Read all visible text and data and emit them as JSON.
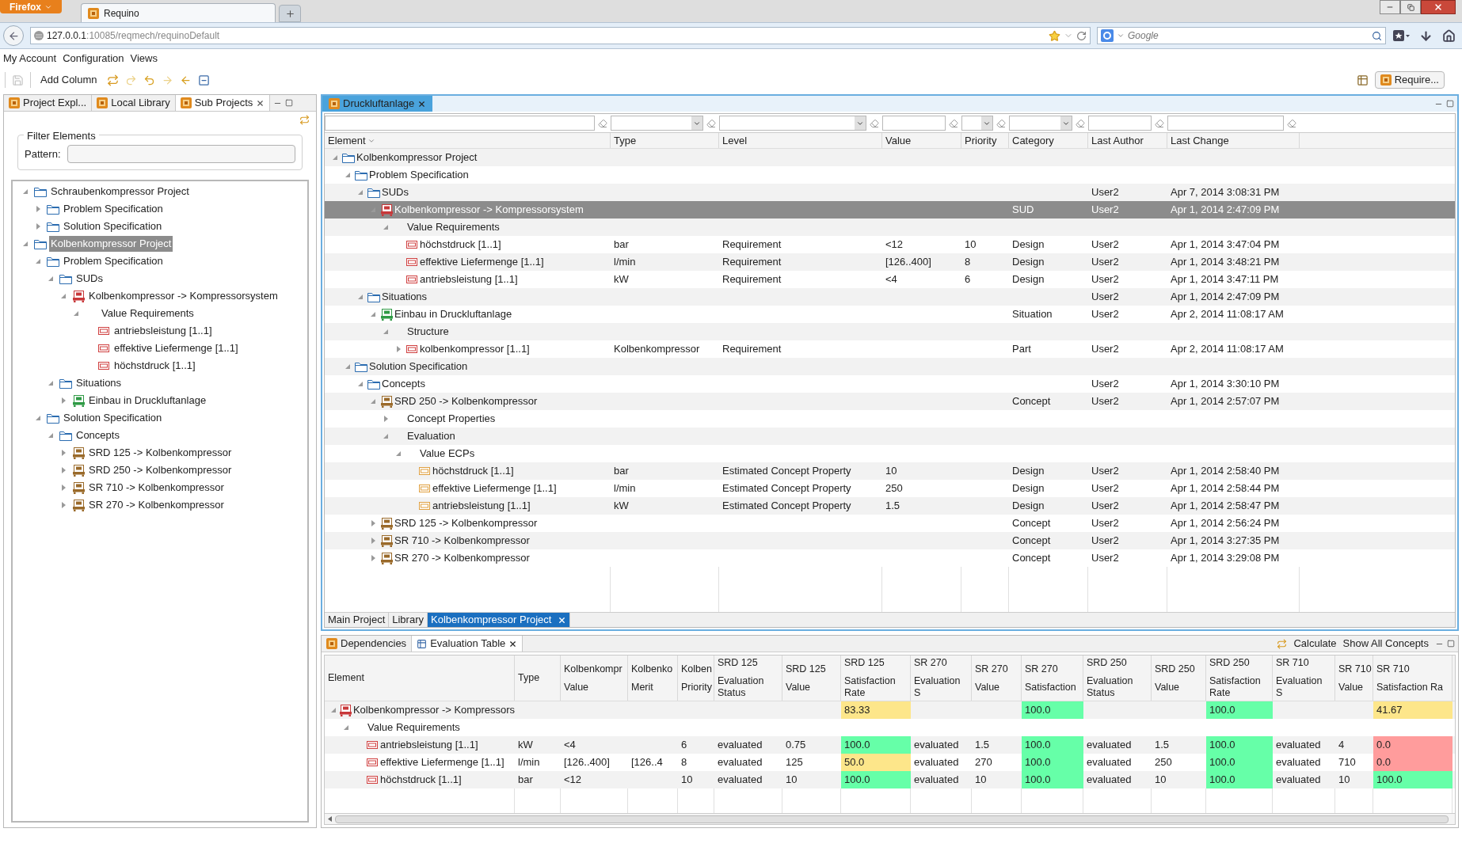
{
  "browser": {
    "menu_button": "Firefox",
    "tab_title": "Requino",
    "url_host": "127.0.0.1",
    "url_rest": ":10085/reqmech/requinoDefault",
    "search_placeholder": "Google"
  },
  "menu": [
    "My Account",
    "Configuration",
    "Views"
  ],
  "toolbar": {
    "add_column": "Add Column",
    "perspective": "Require..."
  },
  "left_panel": {
    "tabs": [
      {
        "label": "Project Expl...",
        "selected": false
      },
      {
        "label": "Local Library",
        "selected": false
      },
      {
        "label": "Sub Projects",
        "selected": true
      }
    ],
    "filter_group": "Filter Elements",
    "pattern_label": "Pattern:",
    "tree": [
      {
        "label": "Schraubenkompressor Project",
        "kind": "folder",
        "expandable": true,
        "expanded": true,
        "selected": false,
        "children": [
          {
            "label": "Problem Specification",
            "kind": "folder",
            "expandable": true,
            "expanded": false,
            "selected": false
          },
          {
            "label": "Solution Specification",
            "kind": "folder",
            "expandable": true,
            "expanded": false,
            "selected": false
          }
        ]
      },
      {
        "label": "Kolbenkompressor Project",
        "kind": "folder",
        "expandable": true,
        "expanded": true,
        "selected": true,
        "children": [
          {
            "label": "Problem Specification",
            "kind": "folder",
            "expandable": true,
            "expanded": true,
            "selected": false,
            "children": [
              {
                "label": "SUDs",
                "kind": "folder",
                "expandable": true,
                "expanded": true,
                "selected": false,
                "children": [
                  {
                    "label": "Kolbenkompressor -> Kompressorsystem",
                    "kind": "sud",
                    "expandable": true,
                    "expanded": true,
                    "selected": false,
                    "children": [
                      {
                        "label": "Value Requirements",
                        "kind": "group",
                        "expandable": true,
                        "expanded": true,
                        "selected": false,
                        "children": [
                          {
                            "label": "antriebsleistung [1..1]",
                            "kind": "requirement",
                            "expandable": false,
                            "selected": false
                          },
                          {
                            "label": "effektive Liefermenge [1..1]",
                            "kind": "requirement",
                            "expandable": false,
                            "selected": false
                          },
                          {
                            "label": "höchstdruck [1..1]",
                            "kind": "requirement",
                            "expandable": false,
                            "selected": false
                          }
                        ]
                      }
                    ]
                  }
                ]
              },
              {
                "label": "Situations",
                "kind": "folder",
                "expandable": true,
                "expanded": true,
                "selected": false,
                "children": [
                  {
                    "label": "Einbau in Druckluftanlage",
                    "kind": "situation",
                    "expandable": true,
                    "expanded": false,
                    "selected": false
                  }
                ]
              }
            ]
          },
          {
            "label": "Solution Specification",
            "kind": "folder",
            "expandable": true,
            "expanded": true,
            "selected": false,
            "children": [
              {
                "label": "Concepts",
                "kind": "folder",
                "expandable": true,
                "expanded": true,
                "selected": false,
                "children": [
                  {
                    "label": "SRD 125 -> Kolbenkompressor",
                    "kind": "concept",
                    "expandable": true,
                    "expanded": false,
                    "selected": false
                  },
                  {
                    "label": "SRD 250 -> Kolbenkompressor",
                    "kind": "concept",
                    "expandable": true,
                    "expanded": false,
                    "selected": false
                  },
                  {
                    "label": "SR 710 -> Kolbenkompressor",
                    "kind": "concept",
                    "expandable": true,
                    "expanded": false,
                    "selected": false
                  },
                  {
                    "label": "SR 270 -> Kolbenkompressor",
                    "kind": "concept",
                    "expandable": true,
                    "expanded": false,
                    "selected": false
                  }
                ]
              }
            ]
          }
        ]
      }
    ]
  },
  "main_panel": {
    "tab": "Druckluftanlage",
    "columns": [
      {
        "label": "Element",
        "kind": "text",
        "sorted": true
      },
      {
        "label": "Type",
        "kind": "select",
        "sorted": false
      },
      {
        "label": "Level",
        "kind": "select",
        "sorted": false
      },
      {
        "label": "Value",
        "kind": "text",
        "sorted": false
      },
      {
        "label": "Priority",
        "kind": "select",
        "sorted": false
      },
      {
        "label": "Category",
        "kind": "select",
        "sorted": false
      },
      {
        "label": "Last Author",
        "kind": "text",
        "sorted": false
      },
      {
        "label": "Last Change",
        "kind": "text",
        "sorted": false
      }
    ],
    "rows": [
      {
        "kind": "folder",
        "expandable": true,
        "expanded": true,
        "selected": false,
        "cells": [
          "Kolbenkompressor Project",
          "",
          "",
          "",
          "",
          "",
          "",
          ""
        ],
        "children": [
          {
            "kind": "folder",
            "expandable": true,
            "expanded": true,
            "selected": false,
            "cells": [
              "Problem Specification",
              "",
              "",
              "",
              "",
              "",
              "",
              ""
            ],
            "children": [
              {
                "kind": "folder",
                "expandable": true,
                "expanded": true,
                "selected": false,
                "cells": [
                  "SUDs",
                  "",
                  "",
                  "",
                  "",
                  "",
                  "User2",
                  "Apr 7, 2014 3:08:31 PM"
                ],
                "children": [
                  {
                    "kind": "sud",
                    "expandable": true,
                    "expanded": true,
                    "selected": true,
                    "cells": [
                      "Kolbenkompressor -> Kompressorsystem",
                      "",
                      "",
                      "",
                      "",
                      "SUD",
                      "User2",
                      "Apr 1, 2014 2:47:09 PM"
                    ],
                    "children": [
                      {
                        "kind": "group",
                        "expandable": true,
                        "expanded": true,
                        "selected": false,
                        "cells": [
                          "Value Requirements",
                          "",
                          "",
                          "",
                          "",
                          "",
                          "",
                          ""
                        ],
                        "children": [
                          {
                            "kind": "requirement",
                            "expandable": false,
                            "selected": false,
                            "cells": [
                              "höchstdruck [1..1]",
                              "bar",
                              "Requirement",
                              "<12",
                              "10",
                              "Design",
                              "User2",
                              "Apr 1, 2014 3:47:04 PM"
                            ]
                          },
                          {
                            "kind": "requirement",
                            "expandable": false,
                            "selected": false,
                            "cells": [
                              "effektive Liefermenge [1..1]",
                              "l/min",
                              "Requirement",
                              "[126..400]",
                              "8",
                              "Design",
                              "User2",
                              "Apr 1, 2014 3:48:21 PM"
                            ]
                          },
                          {
                            "kind": "requirement",
                            "expandable": false,
                            "selected": false,
                            "cells": [
                              "antriebsleistung [1..1]",
                              "kW",
                              "Requirement",
                              "<4",
                              "6",
                              "Design",
                              "User2",
                              "Apr 1, 2014 3:47:11 PM"
                            ]
                          }
                        ]
                      }
                    ]
                  }
                ]
              },
              {
                "kind": "folder",
                "expandable": true,
                "expanded": true,
                "selected": false,
                "cells": [
                  "Situations",
                  "",
                  "",
                  "",
                  "",
                  "",
                  "User2",
                  "Apr 1, 2014 2:47:09 PM"
                ],
                "children": [
                  {
                    "kind": "situation",
                    "expandable": true,
                    "expanded": true,
                    "selected": false,
                    "cells": [
                      "Einbau in Druckluftanlage",
                      "",
                      "",
                      "",
                      "",
                      "Situation",
                      "User2",
                      "Apr 2, 2014 11:08:17 AM"
                    ],
                    "children": [
                      {
                        "kind": "group",
                        "expandable": true,
                        "expanded": true,
                        "selected": false,
                        "cells": [
                          "Structure",
                          "",
                          "",
                          "",
                          "",
                          "",
                          "",
                          ""
                        ],
                        "children": [
                          {
                            "kind": "requirement",
                            "expandable": true,
                            "expanded": false,
                            "selected": false,
                            "cells": [
                              "kolbenkompressor [1..1]",
                              "Kolbenkompressor",
                              "Requirement",
                              "",
                              "",
                              "Part",
                              "User2",
                              "Apr 2, 2014 11:08:17 AM"
                            ]
                          }
                        ]
                      }
                    ]
                  }
                ]
              }
            ]
          },
          {
            "kind": "folder",
            "expandable": true,
            "expanded": true,
            "selected": false,
            "cells": [
              "Solution Specification",
              "",
              "",
              "",
              "",
              "",
              "",
              ""
            ],
            "children": [
              {
                "kind": "folder",
                "expandable": true,
                "expanded": true,
                "selected": false,
                "cells": [
                  "Concepts",
                  "",
                  "",
                  "",
                  "",
                  "",
                  "User2",
                  "Apr 1, 2014 3:30:10 PM"
                ],
                "children": [
                  {
                    "kind": "concept",
                    "expandable": true,
                    "expanded": true,
                    "selected": false,
                    "cells": [
                      "SRD 250 -> Kolbenkompressor",
                      "",
                      "",
                      "",
                      "",
                      "Concept",
                      "User2",
                      "Apr 1, 2014 2:57:07 PM"
                    ],
                    "children": [
                      {
                        "kind": "group",
                        "expandable": true,
                        "expanded": false,
                        "selected": false,
                        "cells": [
                          "Concept Properties",
                          "",
                          "",
                          "",
                          "",
                          "",
                          "",
                          ""
                        ]
                      },
                      {
                        "kind": "group",
                        "expandable": true,
                        "expanded": true,
                        "selected": false,
                        "cells": [
                          "Evaluation",
                          "",
                          "",
                          "",
                          "",
                          "",
                          "",
                          ""
                        ],
                        "children": [
                          {
                            "kind": "group",
                            "expandable": true,
                            "expanded": true,
                            "selected": false,
                            "cells": [
                              "Value ECPs",
                              "",
                              "",
                              "",
                              "",
                              "",
                              "",
                              ""
                            ],
                            "children": [
                              {
                                "kind": "ecp",
                                "expandable": false,
                                "selected": false,
                                "cells": [
                                  "höchstdruck [1..1]",
                                  "bar",
                                  "Estimated Concept Property",
                                  "10",
                                  "",
                                  "Design",
                                  "User2",
                                  "Apr 1, 2014 2:58:40 PM"
                                ]
                              },
                              {
                                "kind": "ecp",
                                "expandable": false,
                                "selected": false,
                                "cells": [
                                  "effektive Liefermenge [1..1]",
                                  "l/min",
                                  "Estimated Concept Property",
                                  "250",
                                  "",
                                  "Design",
                                  "User2",
                                  "Apr 1, 2014 2:58:44 PM"
                                ]
                              },
                              {
                                "kind": "ecp",
                                "expandable": false,
                                "selected": false,
                                "cells": [
                                  "antriebsleistung [1..1]",
                                  "kW",
                                  "Estimated Concept Property",
                                  "1.5",
                                  "",
                                  "Design",
                                  "User2",
                                  "Apr 1, 2014 2:58:47 PM"
                                ]
                              }
                            ]
                          }
                        ]
                      }
                    ]
                  },
                  {
                    "kind": "concept",
                    "expandable": true,
                    "expanded": false,
                    "selected": false,
                    "cells": [
                      "SRD 125 -> Kolbenkompressor",
                      "",
                      "",
                      "",
                      "",
                      "Concept",
                      "User2",
                      "Apr 1, 2014 2:56:24 PM"
                    ]
                  },
                  {
                    "kind": "concept",
                    "expandable": true,
                    "expanded": false,
                    "selected": false,
                    "cells": [
                      "SR 710 -> Kolbenkompressor",
                      "",
                      "",
                      "",
                      "",
                      "Concept",
                      "User2",
                      "Apr 1, 2014 3:27:35 PM"
                    ]
                  },
                  {
                    "kind": "concept",
                    "expandable": true,
                    "expanded": false,
                    "selected": false,
                    "cells": [
                      "SR 270 -> Kolbenkompressor",
                      "",
                      "",
                      "",
                      "",
                      "Concept",
                      "User2",
                      "Apr 1, 2014 3:29:08 PM"
                    ]
                  }
                ]
              }
            ]
          }
        ]
      }
    ],
    "bottom_tabs": [
      {
        "label": "Main Project",
        "selected": false
      },
      {
        "label": "Library",
        "selected": false
      },
      {
        "label": "Kolbenkompressor Project",
        "selected": true
      }
    ]
  },
  "evaluation_panel": {
    "tabs": [
      {
        "label": "Dependencies",
        "selected": false
      },
      {
        "label": "Evaluation Table",
        "selected": true
      }
    ],
    "actions": [
      "Calculate",
      "Show All Concepts"
    ],
    "columns": [
      {
        "label": "Element"
      },
      {
        "label": "Type"
      },
      {
        "group": "Kolbenkompr",
        "label": "Value"
      },
      {
        "group": "Kolbenko",
        "label": "Merit"
      },
      {
        "group": "Kolben",
        "label": "Priority"
      },
      {
        "group": "SRD 125",
        "label": "Evaluation Status"
      },
      {
        "group": "SRD 125",
        "label": "Value"
      },
      {
        "group": "SRD 125",
        "label": "Satisfaction Rate"
      },
      {
        "group": "SR 270",
        "label": "Evaluation S"
      },
      {
        "group": "SR 270",
        "label": "Value"
      },
      {
        "group": "SR 270",
        "label": "Satisfaction"
      },
      {
        "group": "SRD 250",
        "label": "Evaluation Status"
      },
      {
        "group": "SRD 250",
        "label": "Value"
      },
      {
        "group": "SRD 250",
        "label": "Satisfaction Rate"
      },
      {
        "group": "SR 710",
        "label": "Evaluation S"
      },
      {
        "group": "SR 710",
        "label": "Value"
      },
      {
        "group": "SR 710",
        "label": "Satisfaction Ra"
      }
    ],
    "rows": [
      {
        "kind": "sud",
        "expandable": true,
        "expanded": true,
        "cells": [
          "Kolbenkompressor -> Kompressors",
          "",
          "",
          "",
          "",
          "",
          "",
          {
            "text": "83.33",
            "color": "#fde68a"
          },
          "",
          "",
          {
            "text": "100.0",
            "color": "#66ffa8"
          },
          "",
          "",
          {
            "text": "100.0",
            "color": "#66ffa8"
          },
          "",
          "",
          {
            "text": "41.67",
            "color": "#fde68a"
          }
        ],
        "children": [
          {
            "kind": "group",
            "expandable": true,
            "expanded": true,
            "cells": [
              "Value Requirements",
              "",
              "",
              "",
              "",
              "",
              "",
              "",
              "",
              "",
              "",
              "",
              "",
              "",
              "",
              "",
              ""
            ],
            "children": [
              {
                "kind": "requirement",
                "expandable": false,
                "cells": [
                  "antriebsleistung [1..1]",
                  "kW",
                  "<4",
                  "",
                  "6",
                  "evaluated",
                  "0.75",
                  {
                    "text": "100.0",
                    "color": "#66ffa8"
                  },
                  "evaluated",
                  "1.5",
                  {
                    "text": "100.0",
                    "color": "#66ffa8"
                  },
                  "evaluated",
                  "1.5",
                  {
                    "text": "100.0",
                    "color": "#66ffa8"
                  },
                  "evaluated",
                  "4",
                  {
                    "text": "0.0",
                    "color": "#ff9c9c"
                  }
                ]
              },
              {
                "kind": "requirement",
                "expandable": false,
                "cells": [
                  "effektive Liefermenge [1..1]",
                  "l/min",
                  "[126..400]",
                  "[126..4",
                  "8",
                  "evaluated",
                  "125",
                  {
                    "text": "50.0",
                    "color": "#fde68a"
                  },
                  "evaluated",
                  "270",
                  {
                    "text": "100.0",
                    "color": "#66ffa8"
                  },
                  "evaluated",
                  "250",
                  {
                    "text": "100.0",
                    "color": "#66ffa8"
                  },
                  "evaluated",
                  "710",
                  {
                    "text": "0.0",
                    "color": "#ff9c9c"
                  }
                ]
              },
              {
                "kind": "requirement",
                "expandable": false,
                "cells": [
                  "höchstdruck [1..1]",
                  "bar",
                  "<12",
                  "",
                  "10",
                  "evaluated",
                  "10",
                  {
                    "text": "100.0",
                    "color": "#66ffa8"
                  },
                  "evaluated",
                  "10",
                  {
                    "text": "100.0",
                    "color": "#66ffa8"
                  },
                  "evaluated",
                  "10",
                  {
                    "text": "100.0",
                    "color": "#66ffa8"
                  },
                  "evaluated",
                  "10",
                  {
                    "text": "100.0",
                    "color": "#66ffa8"
                  }
                ]
              }
            ]
          }
        ]
      }
    ]
  }
}
